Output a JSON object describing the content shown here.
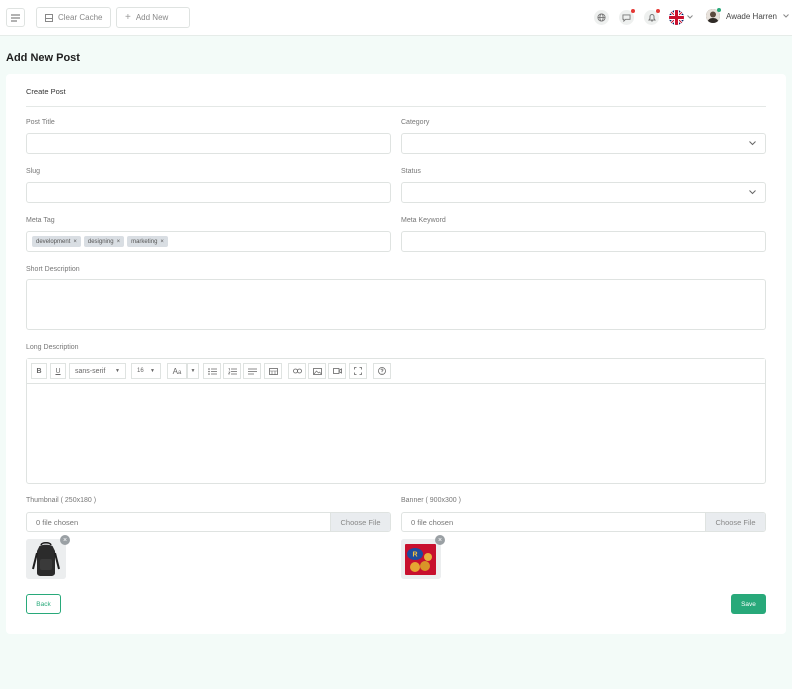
{
  "topbar": {
    "clear_cache_label": "Clear Cache",
    "add_new_label": "Add New",
    "user_name": "Awade Harren"
  },
  "page": {
    "title": "Add New Post"
  },
  "form": {
    "card_title": "Create Post",
    "post_title_label": "Post Title",
    "category_label": "Category",
    "slug_label": "Slug",
    "status_label": "Status",
    "meta_tag_label": "Meta Tag",
    "meta_tags": [
      "development",
      "designing",
      "marketing"
    ],
    "meta_keyword_label": "Meta Keyword",
    "short_description_label": "Short Description",
    "long_description_label": "Long Description",
    "editor": {
      "font_family": "sans-serif",
      "font_size": "16"
    },
    "thumbnail_label": "Thumbnail ( 250x180 )",
    "thumbnail_file": "0 file chosen",
    "banner_label": "Banner ( 900x300 )",
    "banner_file": "0 file chosen",
    "choose_file_label": "Choose File",
    "back_label": "Back",
    "save_label": "Save"
  },
  "colors": {
    "accent": "#28a97a",
    "background": "#f3fbf8",
    "notification_dot": "#e53935"
  }
}
